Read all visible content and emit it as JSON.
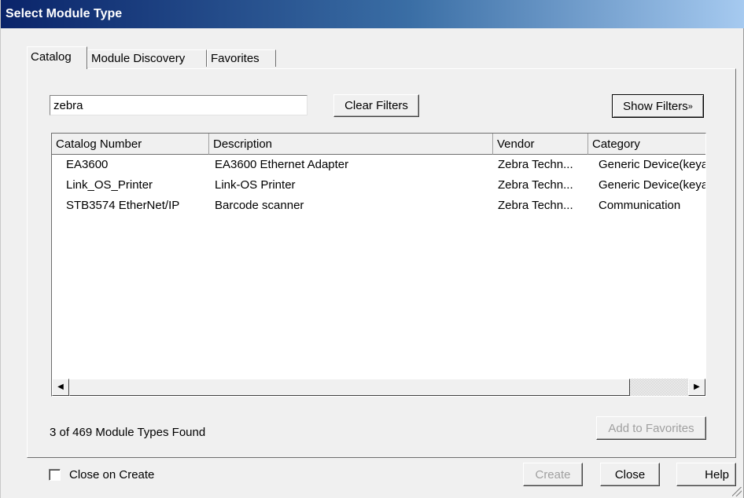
{
  "window": {
    "title": "Select Module Type"
  },
  "tabs": [
    {
      "label": "Catalog",
      "active": true
    },
    {
      "label": "Module Discovery",
      "active": false
    },
    {
      "label": "Favorites",
      "active": false
    }
  ],
  "search": {
    "value": "zebra"
  },
  "buttons": {
    "clear_filters": "Clear Filters",
    "show_filters": "Show Filters",
    "add_to_favorites": "Add to Favorites",
    "create": "Create",
    "close": "Close",
    "help": "Help"
  },
  "table": {
    "columns": [
      "Catalog Number",
      "Description",
      "Vendor",
      "Category"
    ],
    "rows": [
      [
        "EA3600",
        "EA3600 Ethernet Adapter",
        "Zebra Techn...",
        "Generic Device(keyable)"
      ],
      [
        "Link_OS_Printer",
        "Link-OS Printer",
        "Zebra Techn...",
        "Generic Device(keyable)"
      ],
      [
        "STB3574 EtherNet/IP",
        "Barcode scanner",
        "Zebra Techn...",
        "Communication"
      ]
    ]
  },
  "status": {
    "found_text": "3 of 469 Module Types Found"
  },
  "footer": {
    "close_on_create_label": "Close on Create",
    "close_on_create_checked": false
  },
  "icons": {
    "show_filters_icon": "double-chevron-down-icon",
    "scroll_left": "left-arrow-icon",
    "scroll_right": "right-arrow-icon",
    "resize_grip": "resize-grip-icon"
  },
  "colors": {
    "titlebar_start": "#0a246a",
    "titlebar_end": "#a6caf0",
    "disabled_text": "#a0a0a0"
  }
}
